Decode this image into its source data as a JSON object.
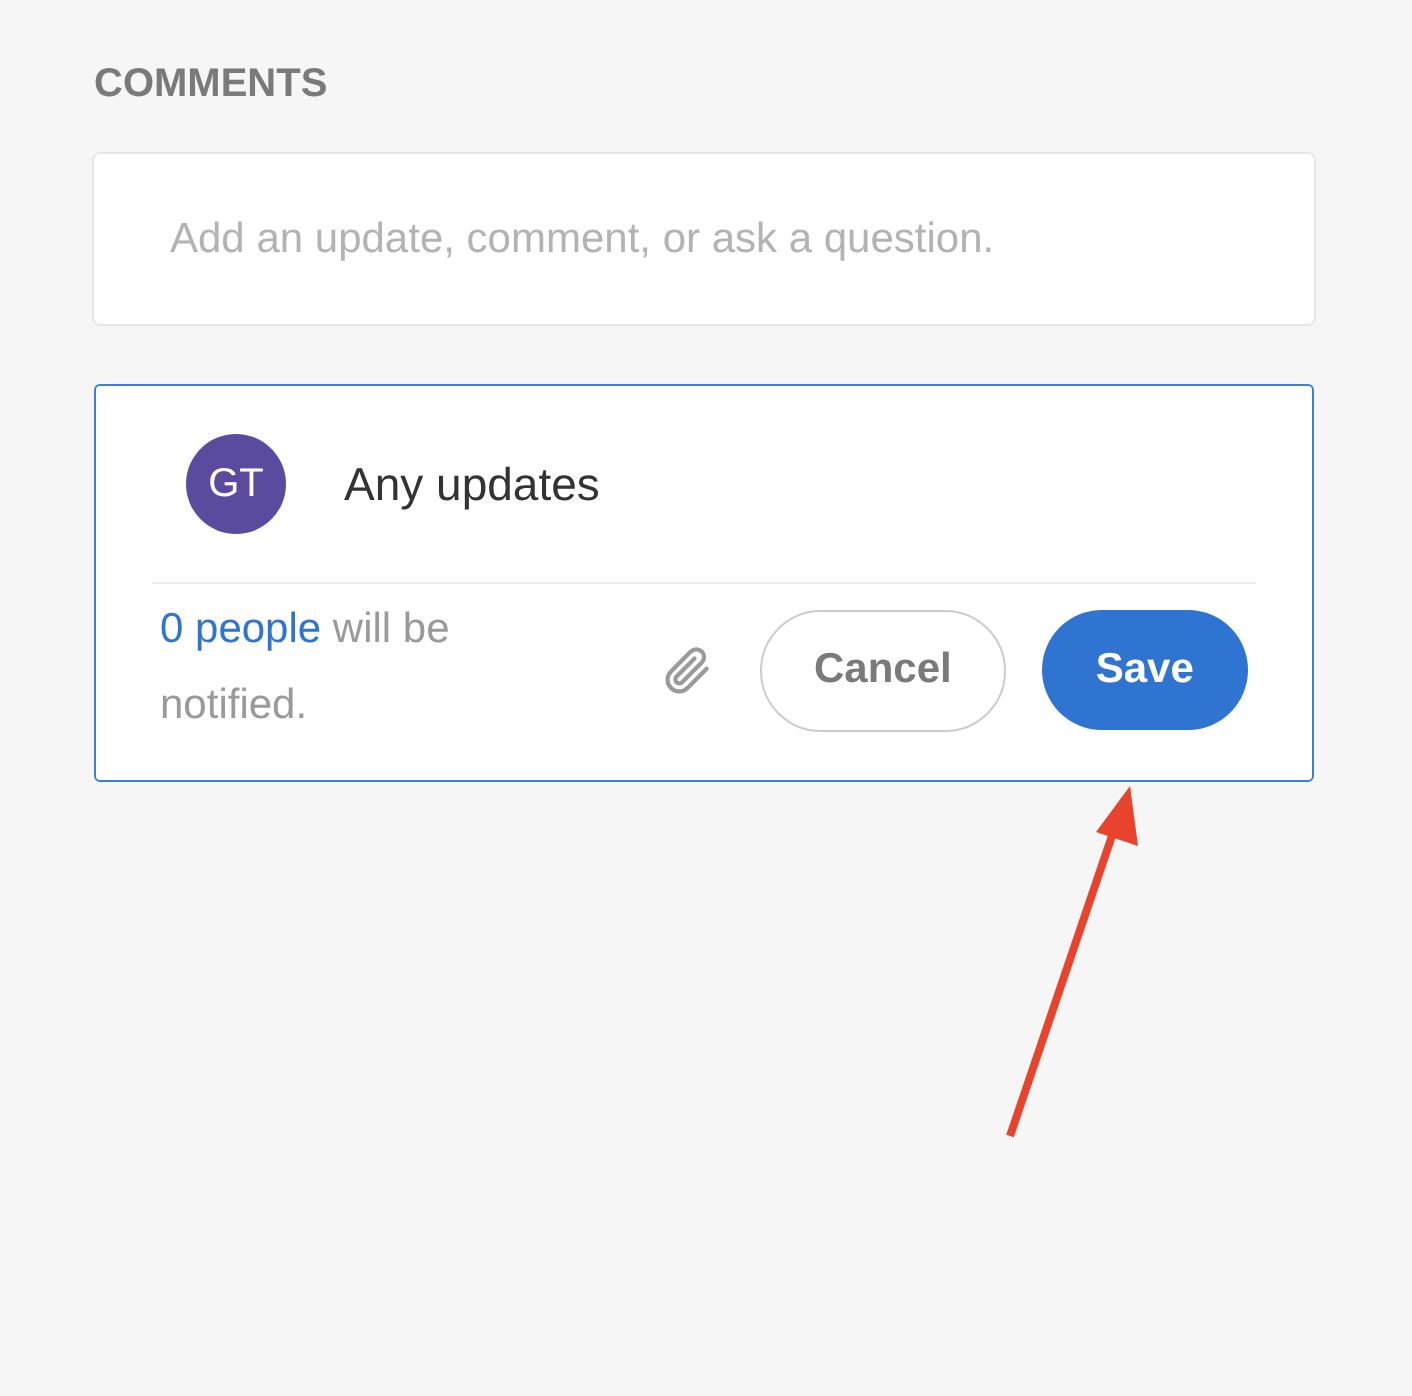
{
  "section_title": "COMMENTS",
  "comment_field": {
    "placeholder": "Add an update, comment, or ask a question."
  },
  "draft": {
    "avatar": "GT",
    "value": "Any updates",
    "notify_link": "0 people",
    "notify_text": "will be notified.",
    "buttons": [
      {
        "kind": "secondary",
        "label": "Cancel"
      },
      {
        "kind": "primary",
        "label": "Save"
      }
    ]
  }
}
